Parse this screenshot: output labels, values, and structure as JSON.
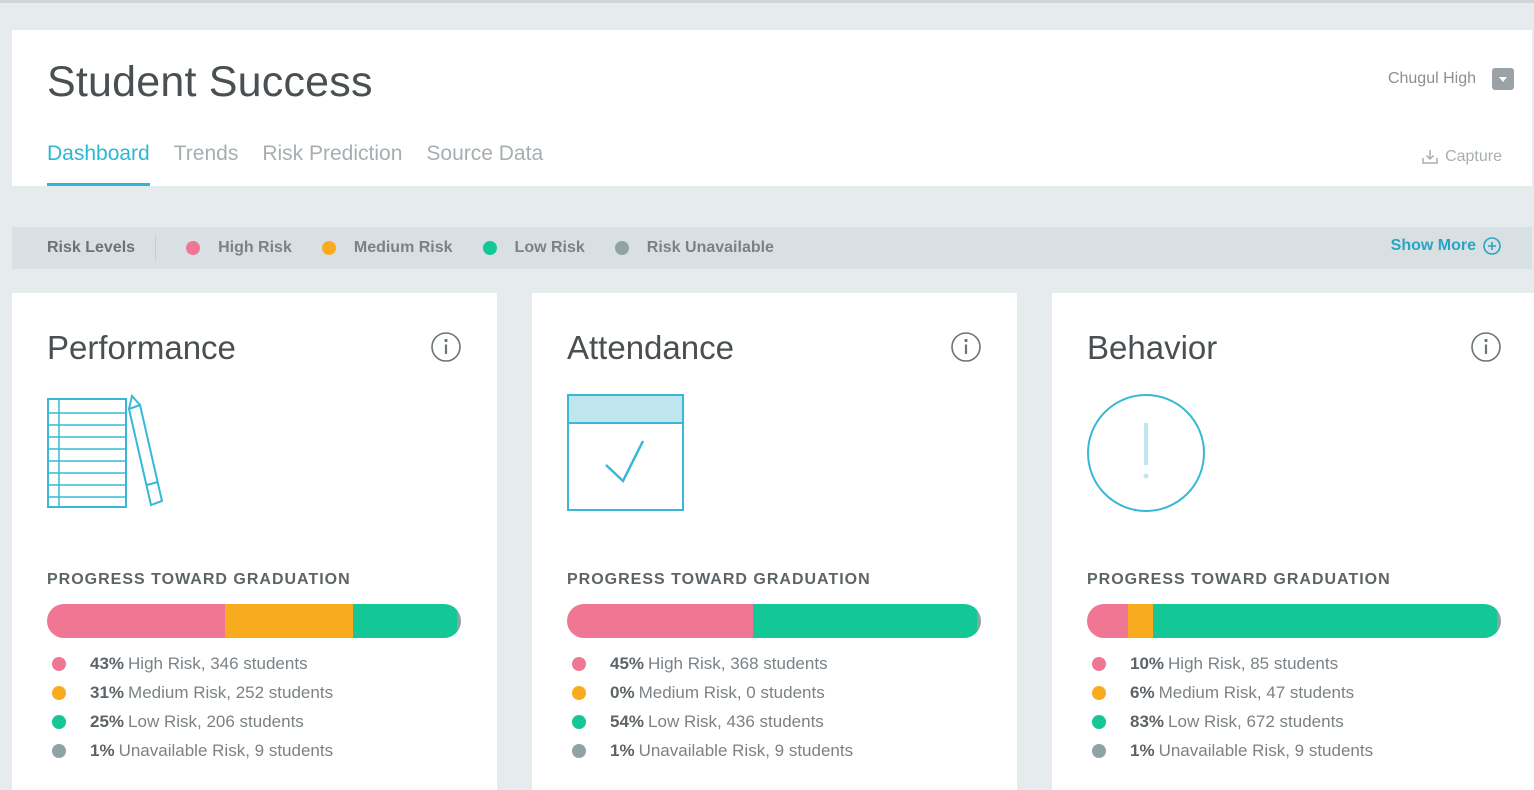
{
  "app": {
    "title": "Student Success",
    "school": "Chugul High",
    "capture_label": "Capture",
    "tabs": [
      {
        "label": "Dashboard",
        "active": true
      },
      {
        "label": "Trends",
        "active": false
      },
      {
        "label": "Risk Prediction",
        "active": false
      },
      {
        "label": "Source Data",
        "active": false
      }
    ]
  },
  "colors": {
    "accent": "#2bb8d4",
    "high": "#f07794",
    "medium": "#f9ab1f",
    "low": "#13c796",
    "unavailable": "#8fa3a4"
  },
  "risk_levels": {
    "label": "Risk Levels",
    "items": [
      {
        "label": "High Risk",
        "color": "#f07794"
      },
      {
        "label": "Medium Risk",
        "color": "#f9ab1f"
      },
      {
        "label": "Low Risk",
        "color": "#13c796"
      },
      {
        "label": "Risk Unavailable",
        "color": "#8fa3a4"
      }
    ],
    "show_more": "Show More"
  },
  "cards": [
    {
      "title": "Performance",
      "icon": "notebook-pencil-icon",
      "progress_label": "PROGRESS TOWARD GRADUATION",
      "segments": [
        43,
        31,
        25,
        1
      ],
      "stats": [
        {
          "pct": "43%",
          "text": "High Risk, 346 students"
        },
        {
          "pct": "31%",
          "text": "Medium Risk, 252 students"
        },
        {
          "pct": "25%",
          "text": "Low Risk, 206 students"
        },
        {
          "pct": "1%",
          "text": "Unavailable Risk, 9 students"
        }
      ]
    },
    {
      "title": "Attendance",
      "icon": "calendar-check-icon",
      "progress_label": "PROGRESS TOWARD GRADUATION",
      "segments": [
        45,
        0,
        54,
        1
      ],
      "stats": [
        {
          "pct": "45%",
          "text": "High Risk, 368 students"
        },
        {
          "pct": "0%",
          "text": "Medium Risk, 0 students"
        },
        {
          "pct": "54%",
          "text": "Low Risk, 436 students"
        },
        {
          "pct": "1%",
          "text": "Unavailable Risk, 9 students"
        }
      ]
    },
    {
      "title": "Behavior",
      "icon": "exclamation-circle-icon",
      "progress_label": "PROGRESS TOWARD GRADUATION",
      "segments": [
        10,
        6,
        83,
        1
      ],
      "stats": [
        {
          "pct": "10%",
          "text": "High Risk, 85 students"
        },
        {
          "pct": "6%",
          "text": "Medium Risk, 47 students"
        },
        {
          "pct": "83%",
          "text": "Low Risk, 672 students"
        },
        {
          "pct": "1%",
          "text": "Unavailable Risk, 9 students"
        }
      ]
    }
  ]
}
